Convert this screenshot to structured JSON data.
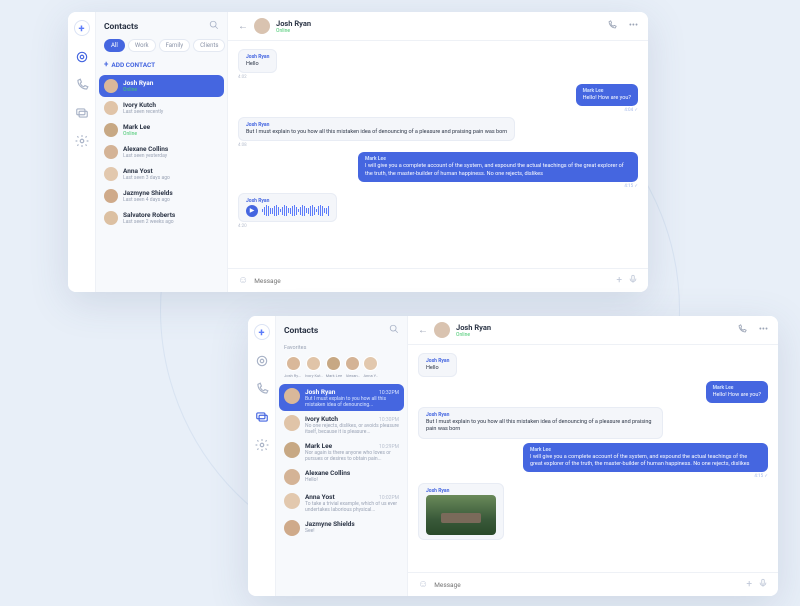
{
  "colors": {
    "accent": "#4566e0",
    "online": "#45c86e"
  },
  "sidebar_icons": [
    "plus",
    "dashboard",
    "phone",
    "chat",
    "settings"
  ],
  "w1": {
    "contacts_title": "Contacts",
    "filters": [
      "All",
      "Work",
      "Family",
      "Clients"
    ],
    "add_contact_label": "ADD CONTACT",
    "contacts": [
      {
        "name": "Josh Ryan",
        "status": "Online",
        "online": true,
        "active": true
      },
      {
        "name": "Ivory Kutch",
        "status": "Last seen recently"
      },
      {
        "name": "Mark Lee",
        "status": "Online",
        "online": true
      },
      {
        "name": "Alexane Collins",
        "status": "Last seen yesterday"
      },
      {
        "name": "Anna Yost",
        "status": "Last seen 3 days ago"
      },
      {
        "name": "Jazmyne Shields",
        "status": "Last seen 4 days ago"
      },
      {
        "name": "Salvatore Roberts",
        "status": "Last seen 2 weeks ago"
      }
    ],
    "chat": {
      "name": "Josh Ryan",
      "status": "Online",
      "messages": [
        {
          "dir": "in",
          "from": "Josh Ryan",
          "body": "Hello",
          "time": "4:02"
        },
        {
          "dir": "out",
          "from": "Mark Lee",
          "body": "Hello! How are you?",
          "time": "4:04 ✓"
        },
        {
          "dir": "in",
          "from": "Josh Ryan",
          "body": "But I must explain to you how all this mistaken idea of denouncing of a pleasure and praising pain was born",
          "time": "4:08"
        },
        {
          "dir": "out",
          "from": "Mark Lee",
          "body": "I will give you a complete account of the system, and expound the actual teachings of the great explorer of the truth, the master-builder of human happiness. No one rejects, dislikes",
          "time": "4:15 ✓"
        },
        {
          "dir": "in",
          "from": "Josh Ryan",
          "type": "voice",
          "time": "4:20"
        }
      ],
      "composer_placeholder": "Message"
    }
  },
  "w2": {
    "contacts_title": "Contacts",
    "favorites_label": "Favorites",
    "favorites": [
      "Josh Ryan",
      "Ivory Kut..",
      "Mark Lee",
      "Alexan..",
      "Anna Y.."
    ],
    "contacts": [
      {
        "name": "Josh Ryan",
        "preview": "But I must explain to you how all this mistaken idea of denouncing...",
        "time": "10:32PM",
        "active": true
      },
      {
        "name": "Ivory Kutch",
        "preview": "No one rejects, dislikes, or avoids pleasure itself, because it is pleasure...",
        "time": "10:30PM"
      },
      {
        "name": "Mark Lee",
        "preview": "Nor again is there anyone who loves or pursues or desires to obtain pain...",
        "time": "10:29PM"
      },
      {
        "name": "Alexane Collins",
        "preview": "Hello!",
        "time": ""
      },
      {
        "name": "Anna Yost",
        "preview": "To take a trivial example, which of us ever undertakes laborious physical...",
        "time": "10:02PM"
      },
      {
        "name": "Jazmyne Shields",
        "preview": "See!",
        "time": ""
      }
    ],
    "chat": {
      "name": "Josh Ryan",
      "status": "Online",
      "messages": [
        {
          "dir": "in",
          "from": "Josh Ryan",
          "body": "Hello",
          "time": ""
        },
        {
          "dir": "out",
          "from": "Mark Lee",
          "body": "Hello! How are you?",
          "time": ""
        },
        {
          "dir": "in",
          "from": "Josh Ryan",
          "body": "But I must explain to you how all this mistaken idea of denouncing of a pleasure and praising pain was born",
          "time": ""
        },
        {
          "dir": "out",
          "from": "Mark Lee",
          "body": "I will give you a complete account of the system, and expound the actual teachings of the great explorer of the truth, the master-builder of human happiness. No one rejects, dislikes",
          "time": "4:15 ✓"
        },
        {
          "dir": "in",
          "from": "Josh Ryan",
          "type": "image",
          "time": ""
        }
      ],
      "composer_placeholder": "Message"
    }
  }
}
